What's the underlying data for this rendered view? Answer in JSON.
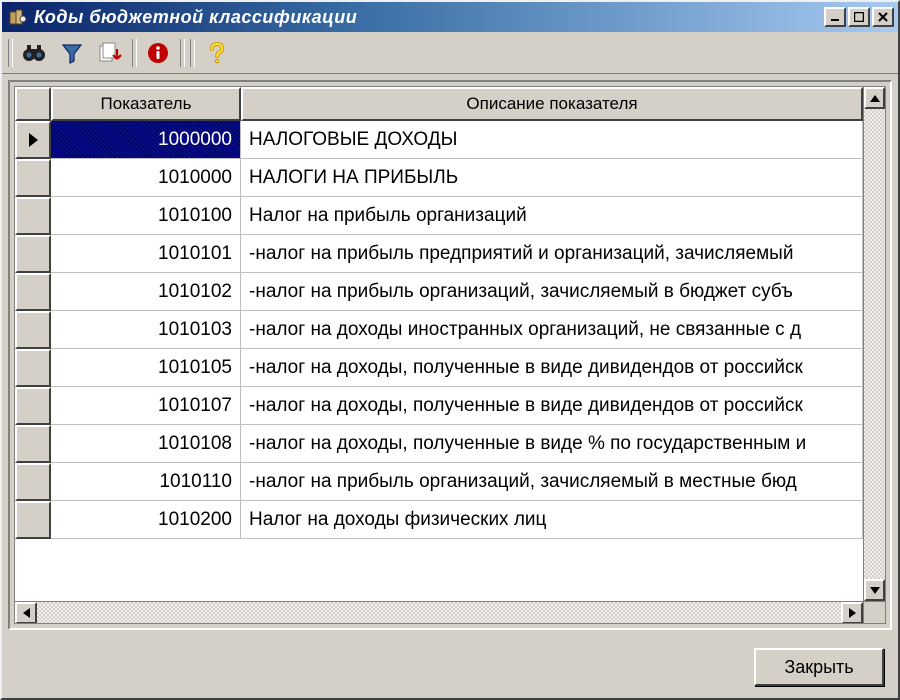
{
  "window": {
    "title": "Коды бюджетной классификации"
  },
  "toolbar": {
    "items": [
      {
        "name": "binoculars-icon"
      },
      {
        "name": "filter-icon"
      },
      {
        "name": "export-icon"
      },
      {
        "name": "info-icon"
      },
      {
        "name": "help-icon"
      }
    ]
  },
  "grid": {
    "columns": {
      "code": "Показатель",
      "desc": "Описание показателя"
    },
    "rows": [
      {
        "code": "1000000",
        "desc": "НАЛОГОВЫЕ ДОХОДЫ",
        "selected": true
      },
      {
        "code": "1010000",
        "desc": "НАЛОГИ НА ПРИБЫЛЬ"
      },
      {
        "code": "1010100",
        "desc": "Налог на прибыль организаций"
      },
      {
        "code": "1010101",
        "desc": "-налог на прибыль предприятий и организаций, зачисляемый"
      },
      {
        "code": "1010102",
        "desc": "-налог на прибыль организаций, зачисляемый в бюджет субъ"
      },
      {
        "code": "1010103",
        "desc": "-налог на доходы иностранных организаций, не связанные с д"
      },
      {
        "code": "1010105",
        "desc": "-налог на доходы, полученные в виде дивидендов от российск"
      },
      {
        "code": "1010107",
        "desc": "-налог на доходы, полученные в виде дивидендов от российск"
      },
      {
        "code": "1010108",
        "desc": "-налог на доходы, полученные в виде % по государственным и"
      },
      {
        "code": "1010110",
        "desc": "-налог на прибыль организаций, зачисляемый в местные бюд"
      },
      {
        "code": "1010200",
        "desc": "Налог на доходы физических лиц"
      }
    ]
  },
  "buttons": {
    "close": "Закрыть"
  }
}
